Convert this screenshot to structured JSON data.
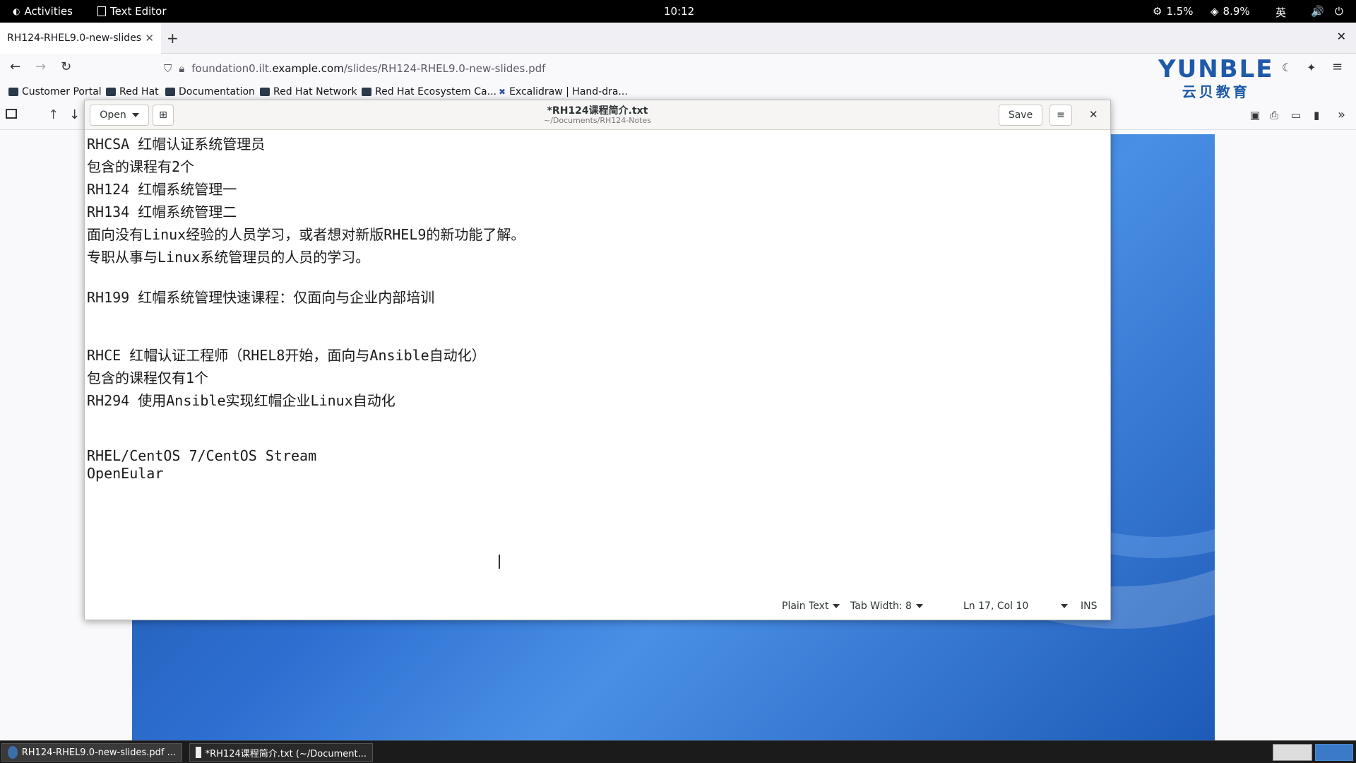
{
  "topbar": {
    "activities": "Activities",
    "app_name": "Text Editor",
    "clock": "10:12",
    "cpu": "1.5%",
    "mem": "8.9%",
    "input_method": "英"
  },
  "browser": {
    "tab_title": "RH124-RHEL9.0-new-slides",
    "url_prefix": "foundation0.ilt.",
    "url_domain": "example.com",
    "url_path": "/slides/RH124-RHEL9.0-new-slides.pdf",
    "bookmarks": [
      "Customer Portal",
      "Red Hat",
      "Documentation",
      "Red Hat Network",
      "Red Hat Ecosystem Ca...",
      "Excalidraw | Hand-dra..."
    ]
  },
  "logo": {
    "en": "YUNBLE",
    "cn": "云贝教育"
  },
  "editor": {
    "title": "*RH124课程简介.txt",
    "subtitle": "~/Documents/RH124-Notes",
    "open_label": "Open",
    "save_label": "Save",
    "lines": [
      "RHCSA 红帽认证系统管理员",
      "包含的课程有2个",
      "RH124 红帽系统管理一",
      "RH134 红帽系统管理二",
      "面向没有Linux经验的人员学习，或者想对新版RHEL9的新功能了解。",
      "专职从事与Linux系统管理员的人员的学习。",
      "",
      "RH199 红帽系统管理快速课程：仅面向与企业内部培训",
      "",
      "",
      "RHCE 红帽认证工程师（RHEL8开始，面向与Ansible自动化）",
      "包含的课程仅有1个",
      "RH294 使用Ansible实现红帽企业Linux自动化",
      "",
      "",
      "RHEL/CentOS 7/CentOS Stream",
      "OpenEular"
    ],
    "status": {
      "language": "Plain Text",
      "tab_width": "Tab Width: 8",
      "position": "Ln 17, Col 10",
      "mode": "INS"
    }
  },
  "taskbar": {
    "items": [
      "RH124-RHEL9.0-new-slides.pdf ...",
      "*RH124课程简介.txt (~/Document..."
    ]
  }
}
